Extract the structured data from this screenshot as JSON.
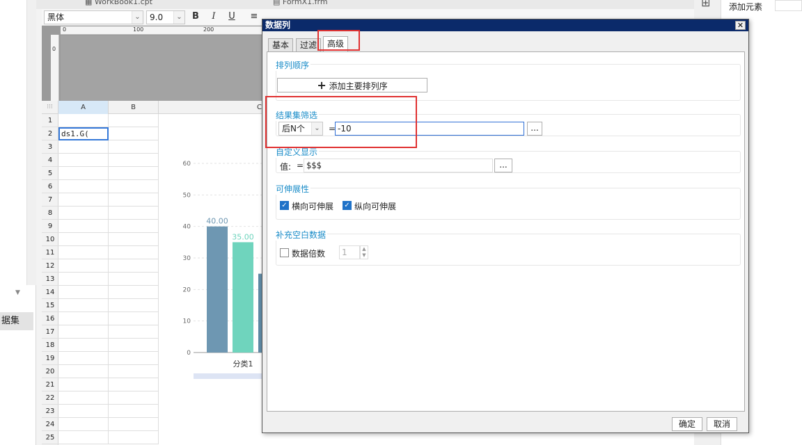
{
  "left_pane": {
    "collapse_icon": "chevron-down-icon",
    "tab_label": "据集"
  },
  "file_tabs": [
    {
      "label": "WorkBook1.cpt",
      "icon": "worksheet-icon"
    },
    {
      "label": "FormX1.frm",
      "icon": "form-icon"
    }
  ],
  "toolbar": {
    "font_name": "黑体",
    "font_size": "9.0",
    "bold": "B",
    "italic": "I",
    "underline": "U"
  },
  "right_pane": {
    "add_element_label": "添加元素",
    "grid_icon": "layout-grid-icon"
  },
  "ruler": {
    "h_labels": [
      "0",
      "100",
      "200"
    ],
    "v_label": "0"
  },
  "sheet": {
    "columns": [
      "A",
      "B",
      "C"
    ],
    "rows": [
      "1",
      "2",
      "3",
      "4",
      "5",
      "6",
      "7",
      "8",
      "9",
      "10",
      "11",
      "12",
      "13",
      "14",
      "15",
      "16",
      "17",
      "18",
      "19",
      "20",
      "21",
      "22",
      "23",
      "24",
      "25"
    ],
    "cell_a2": "ds1.G("
  },
  "chart_data": {
    "type": "bar",
    "categories": [
      "分类1"
    ],
    "series": [
      {
        "values": [
          40.0
        ],
        "color": "#6e97b2"
      },
      {
        "values": [
          35.0
        ],
        "color": "#6fd4bd"
      },
      {
        "values": [
          25.0
        ],
        "color": "#5f89a5"
      }
    ],
    "value_labels": [
      "40.00",
      "35.00",
      "2"
    ],
    "y_ticks": [
      "0",
      "10",
      "20",
      "30",
      "40",
      "50",
      "60"
    ],
    "ylim": [
      0,
      60
    ],
    "grid": true
  },
  "dialog": {
    "title": "数据列",
    "close": "✕",
    "tabs": [
      "基本",
      "过滤",
      "高级"
    ],
    "active_tab": "高级",
    "sort_section": {
      "title": "排列顺序",
      "add_button": "添加主要排列序",
      "add_icon": "plus-icon"
    },
    "filter_section": {
      "title": "结果集筛选",
      "mode": "后N个",
      "equals": "=",
      "value": "-10",
      "more": "..."
    },
    "custom_section": {
      "title": "自定义显示",
      "label": "值:",
      "equals": "=",
      "value": "$$$",
      "more": "..."
    },
    "expand_section": {
      "title": "可伸展性",
      "horizontal": "横向可伸展",
      "vertical": "纵向可伸展",
      "horizontal_checked": true,
      "vertical_checked": true
    },
    "fill_section": {
      "title": "补充空白数据",
      "multiple_label": "数据倍数",
      "multiple_value": "1",
      "checked": false
    },
    "ok": "确定",
    "cancel": "取消"
  },
  "highlight_color": "#e03030"
}
